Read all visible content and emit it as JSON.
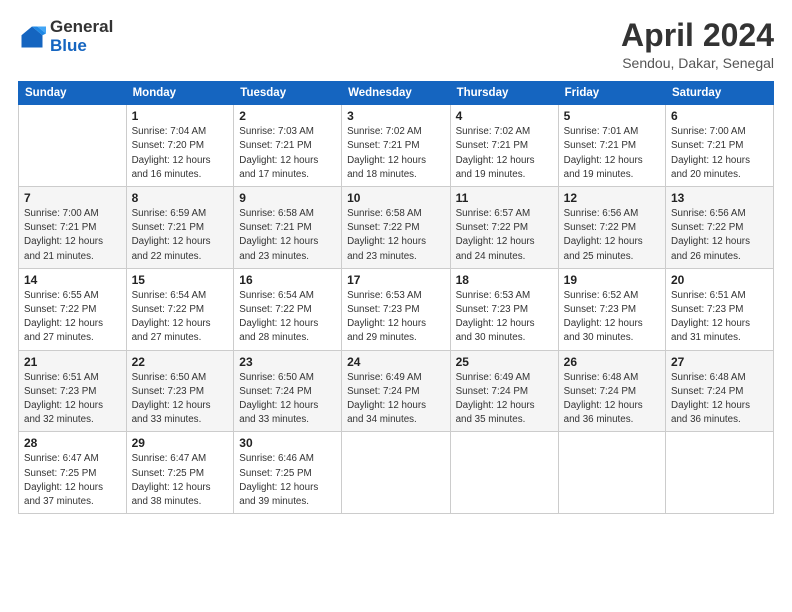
{
  "logo": {
    "general": "General",
    "blue": "Blue"
  },
  "title": "April 2024",
  "location": "Sendou, Dakar, Senegal",
  "headers": [
    "Sunday",
    "Monday",
    "Tuesday",
    "Wednesday",
    "Thursday",
    "Friday",
    "Saturday"
  ],
  "weeks": [
    [
      {
        "day": "",
        "info": ""
      },
      {
        "day": "1",
        "info": "Sunrise: 7:04 AM\nSunset: 7:20 PM\nDaylight: 12 hours\nand 16 minutes."
      },
      {
        "day": "2",
        "info": "Sunrise: 7:03 AM\nSunset: 7:21 PM\nDaylight: 12 hours\nand 17 minutes."
      },
      {
        "day": "3",
        "info": "Sunrise: 7:02 AM\nSunset: 7:21 PM\nDaylight: 12 hours\nand 18 minutes."
      },
      {
        "day": "4",
        "info": "Sunrise: 7:02 AM\nSunset: 7:21 PM\nDaylight: 12 hours\nand 19 minutes."
      },
      {
        "day": "5",
        "info": "Sunrise: 7:01 AM\nSunset: 7:21 PM\nDaylight: 12 hours\nand 19 minutes."
      },
      {
        "day": "6",
        "info": "Sunrise: 7:00 AM\nSunset: 7:21 PM\nDaylight: 12 hours\nand 20 minutes."
      }
    ],
    [
      {
        "day": "7",
        "info": "Sunrise: 7:00 AM\nSunset: 7:21 PM\nDaylight: 12 hours\nand 21 minutes."
      },
      {
        "day": "8",
        "info": "Sunrise: 6:59 AM\nSunset: 7:21 PM\nDaylight: 12 hours\nand 22 minutes."
      },
      {
        "day": "9",
        "info": "Sunrise: 6:58 AM\nSunset: 7:21 PM\nDaylight: 12 hours\nand 23 minutes."
      },
      {
        "day": "10",
        "info": "Sunrise: 6:58 AM\nSunset: 7:22 PM\nDaylight: 12 hours\nand 23 minutes."
      },
      {
        "day": "11",
        "info": "Sunrise: 6:57 AM\nSunset: 7:22 PM\nDaylight: 12 hours\nand 24 minutes."
      },
      {
        "day": "12",
        "info": "Sunrise: 6:56 AM\nSunset: 7:22 PM\nDaylight: 12 hours\nand 25 minutes."
      },
      {
        "day": "13",
        "info": "Sunrise: 6:56 AM\nSunset: 7:22 PM\nDaylight: 12 hours\nand 26 minutes."
      }
    ],
    [
      {
        "day": "14",
        "info": "Sunrise: 6:55 AM\nSunset: 7:22 PM\nDaylight: 12 hours\nand 27 minutes."
      },
      {
        "day": "15",
        "info": "Sunrise: 6:54 AM\nSunset: 7:22 PM\nDaylight: 12 hours\nand 27 minutes."
      },
      {
        "day": "16",
        "info": "Sunrise: 6:54 AM\nSunset: 7:22 PM\nDaylight: 12 hours\nand 28 minutes."
      },
      {
        "day": "17",
        "info": "Sunrise: 6:53 AM\nSunset: 7:23 PM\nDaylight: 12 hours\nand 29 minutes."
      },
      {
        "day": "18",
        "info": "Sunrise: 6:53 AM\nSunset: 7:23 PM\nDaylight: 12 hours\nand 30 minutes."
      },
      {
        "day": "19",
        "info": "Sunrise: 6:52 AM\nSunset: 7:23 PM\nDaylight: 12 hours\nand 30 minutes."
      },
      {
        "day": "20",
        "info": "Sunrise: 6:51 AM\nSunset: 7:23 PM\nDaylight: 12 hours\nand 31 minutes."
      }
    ],
    [
      {
        "day": "21",
        "info": "Sunrise: 6:51 AM\nSunset: 7:23 PM\nDaylight: 12 hours\nand 32 minutes."
      },
      {
        "day": "22",
        "info": "Sunrise: 6:50 AM\nSunset: 7:23 PM\nDaylight: 12 hours\nand 33 minutes."
      },
      {
        "day": "23",
        "info": "Sunrise: 6:50 AM\nSunset: 7:24 PM\nDaylight: 12 hours\nand 33 minutes."
      },
      {
        "day": "24",
        "info": "Sunrise: 6:49 AM\nSunset: 7:24 PM\nDaylight: 12 hours\nand 34 minutes."
      },
      {
        "day": "25",
        "info": "Sunrise: 6:49 AM\nSunset: 7:24 PM\nDaylight: 12 hours\nand 35 minutes."
      },
      {
        "day": "26",
        "info": "Sunrise: 6:48 AM\nSunset: 7:24 PM\nDaylight: 12 hours\nand 36 minutes."
      },
      {
        "day": "27",
        "info": "Sunrise: 6:48 AM\nSunset: 7:24 PM\nDaylight: 12 hours\nand 36 minutes."
      }
    ],
    [
      {
        "day": "28",
        "info": "Sunrise: 6:47 AM\nSunset: 7:25 PM\nDaylight: 12 hours\nand 37 minutes."
      },
      {
        "day": "29",
        "info": "Sunrise: 6:47 AM\nSunset: 7:25 PM\nDaylight: 12 hours\nand 38 minutes."
      },
      {
        "day": "30",
        "info": "Sunrise: 6:46 AM\nSunset: 7:25 PM\nDaylight: 12 hours\nand 39 minutes."
      },
      {
        "day": "",
        "info": ""
      },
      {
        "day": "",
        "info": ""
      },
      {
        "day": "",
        "info": ""
      },
      {
        "day": "",
        "info": ""
      }
    ]
  ]
}
